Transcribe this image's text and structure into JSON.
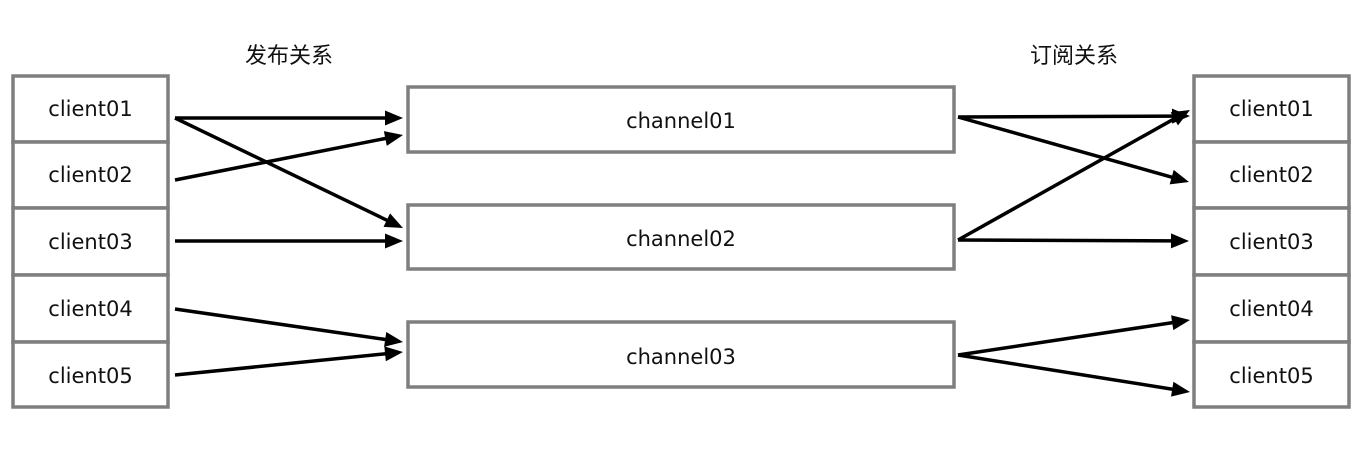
{
  "titles": {
    "publish": "发布关系",
    "subscribe": "订阅关系"
  },
  "publishers": [
    {
      "id": "p1",
      "label": "client01"
    },
    {
      "id": "p2",
      "label": "client02"
    },
    {
      "id": "p3",
      "label": "client03"
    },
    {
      "id": "p4",
      "label": "client04"
    },
    {
      "id": "p5",
      "label": "client05"
    }
  ],
  "channels": [
    {
      "id": "c1",
      "label": "channel01"
    },
    {
      "id": "c2",
      "label": "channel02"
    },
    {
      "id": "c3",
      "label": "channel03"
    }
  ],
  "subscribers": [
    {
      "id": "s1",
      "label": "client01"
    },
    {
      "id": "s2",
      "label": "client02"
    },
    {
      "id": "s3",
      "label": "client03"
    },
    {
      "id": "s4",
      "label": "client04"
    },
    {
      "id": "s5",
      "label": "client05"
    }
  ],
  "publish_edges": [
    {
      "from": "p1",
      "to": "c1"
    },
    {
      "from": "p1",
      "to": "c2"
    },
    {
      "from": "p2",
      "to": "c1"
    },
    {
      "from": "p3",
      "to": "c2"
    },
    {
      "from": "p4",
      "to": "c3"
    },
    {
      "from": "p5",
      "to": "c3"
    }
  ],
  "subscribe_edges": [
    {
      "from": "c1",
      "to": "s1"
    },
    {
      "from": "c1",
      "to": "s2"
    },
    {
      "from": "c2",
      "to": "s1"
    },
    {
      "from": "c2",
      "to": "s3"
    },
    {
      "from": "c3",
      "to": "s4"
    },
    {
      "from": "c3",
      "to": "s5"
    }
  ],
  "colors": {
    "node_border": "#7f7f7f",
    "edge": "#000000",
    "text": "#111111",
    "background": "#ffffff"
  }
}
